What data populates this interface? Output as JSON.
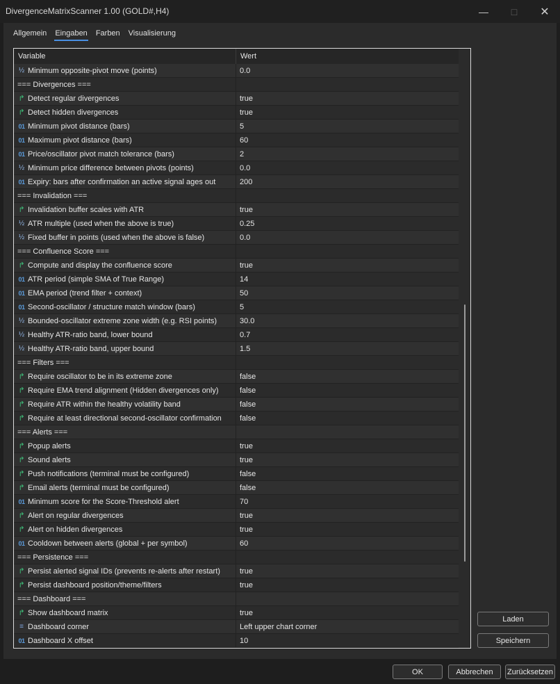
{
  "window": {
    "title": "DivergenceMatrixScanner 1.00 (GOLD#,H4)"
  },
  "tabs": [
    {
      "label": "Allgemein",
      "active": false
    },
    {
      "label": "Eingaben",
      "active": true
    },
    {
      "label": "Farben",
      "active": false
    },
    {
      "label": "Visualisierung",
      "active": false
    }
  ],
  "table": {
    "headers": {
      "variable": "Variable",
      "value": "Wert"
    },
    "rows": [
      {
        "type": "double",
        "name": "Minimum opposite-pivot move (points)",
        "value": "0.0"
      },
      {
        "type": "section",
        "name": "=== Divergences ===",
        "value": ""
      },
      {
        "type": "bool",
        "name": "Detect regular divergences",
        "value": "true"
      },
      {
        "type": "bool",
        "name": "Detect hidden divergences",
        "value": "true"
      },
      {
        "type": "int",
        "name": "Minimum pivot distance (bars)",
        "value": "5"
      },
      {
        "type": "int",
        "name": "Maximum pivot distance (bars)",
        "value": "60"
      },
      {
        "type": "int",
        "name": "Price/oscillator pivot match tolerance (bars)",
        "value": "2"
      },
      {
        "type": "double",
        "name": "Minimum price difference between pivots (points)",
        "value": "0.0"
      },
      {
        "type": "int",
        "name": "Expiry: bars after confirmation an active signal ages out",
        "value": "200"
      },
      {
        "type": "section",
        "name": "=== Invalidation ===",
        "value": ""
      },
      {
        "type": "bool",
        "name": "Invalidation buffer scales with ATR",
        "value": "true"
      },
      {
        "type": "double",
        "name": "ATR multiple (used when the above is true)",
        "value": "0.25"
      },
      {
        "type": "double",
        "name": "Fixed buffer in points (used when the above is false)",
        "value": "0.0"
      },
      {
        "type": "section",
        "name": "=== Confluence Score ===",
        "value": ""
      },
      {
        "type": "bool",
        "name": "Compute and display the confluence score",
        "value": "true"
      },
      {
        "type": "int",
        "name": "ATR period (simple SMA of True Range)",
        "value": "14"
      },
      {
        "type": "int",
        "name": "EMA period (trend filter + context)",
        "value": "50"
      },
      {
        "type": "int",
        "name": "Second-oscillator / structure match window (bars)",
        "value": "5"
      },
      {
        "type": "double",
        "name": "Bounded-oscillator extreme zone width (e.g. RSI points)",
        "value": "30.0"
      },
      {
        "type": "double",
        "name": "Healthy ATR-ratio band, lower bound",
        "value": "0.7"
      },
      {
        "type": "double",
        "name": "Healthy ATR-ratio band, upper bound",
        "value": "1.5"
      },
      {
        "type": "section",
        "name": "=== Filters ===",
        "value": ""
      },
      {
        "type": "bool",
        "name": "Require oscillator to be in its extreme zone",
        "value": "false"
      },
      {
        "type": "bool",
        "name": "Require EMA trend alignment (Hidden divergences only)",
        "value": "false"
      },
      {
        "type": "bool",
        "name": "Require ATR within the healthy volatility band",
        "value": "false"
      },
      {
        "type": "bool",
        "name": "Require at least directional second-oscillator confirmation",
        "value": "false"
      },
      {
        "type": "section",
        "name": "=== Alerts ===",
        "value": ""
      },
      {
        "type": "bool",
        "name": "Popup alerts",
        "value": "true"
      },
      {
        "type": "bool",
        "name": "Sound alerts",
        "value": "true"
      },
      {
        "type": "bool",
        "name": "Push notifications (terminal must be configured)",
        "value": "false"
      },
      {
        "type": "bool",
        "name": "Email alerts (terminal must be configured)",
        "value": "false"
      },
      {
        "type": "int",
        "name": "Minimum score for the Score-Threshold alert",
        "value": "70"
      },
      {
        "type": "bool",
        "name": "Alert on regular divergences",
        "value": "true"
      },
      {
        "type": "bool",
        "name": "Alert on hidden divergences",
        "value": "true"
      },
      {
        "type": "int",
        "name": "Cooldown between alerts (global + per symbol)",
        "value": "60"
      },
      {
        "type": "section",
        "name": "=== Persistence ===",
        "value": ""
      },
      {
        "type": "bool",
        "name": "Persist alerted signal IDs (prevents re-alerts after restart)",
        "value": "true"
      },
      {
        "type": "bool",
        "name": "Persist dashboard position/theme/filters",
        "value": "true"
      },
      {
        "type": "section",
        "name": "=== Dashboard ===",
        "value": ""
      },
      {
        "type": "bool",
        "name": "Show dashboard matrix",
        "value": "true"
      },
      {
        "type": "enum",
        "name": "Dashboard corner",
        "value": "Left upper chart corner"
      },
      {
        "type": "int",
        "name": "Dashboard X offset",
        "value": "10"
      }
    ]
  },
  "icons": {
    "bool": "↱",
    "int": "01",
    "double": "½",
    "enum": "≡"
  },
  "side_buttons": {
    "load": "Laden",
    "save": "Speichern"
  },
  "bottom_buttons": {
    "ok": "OK",
    "cancel": "Abbrechen",
    "reset": "Zurücksetzen"
  }
}
